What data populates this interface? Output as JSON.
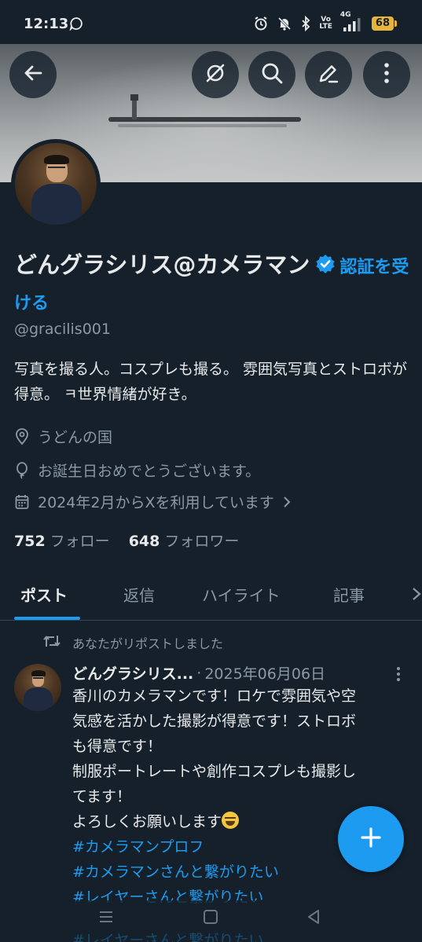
{
  "status_bar": {
    "time": "12:13",
    "network": "4G",
    "battery": "68",
    "volte_top": "Vo",
    "volte_bottom": "LTE"
  },
  "header": {
    "back_icon": "arrow-left-icon",
    "actions": [
      "grok-icon",
      "search-icon",
      "edit-icon",
      "more-vertical-icon"
    ]
  },
  "profile": {
    "display_name": "どんグラシリス@カメラマン",
    "verify_prompt": "認証を受ける",
    "handle": "@gracilis001",
    "bio": "写真を撮る人。コスプレも撮る。 雰囲気写真とストロボが得意。 ㅋ世界情緒が好き。",
    "location": "うどんの国",
    "birthday": "お誕生日おめでとうございます。",
    "joined": "2024年2月からXを利用しています",
    "following_count": "752",
    "following_label": "フォロー",
    "followers_count": "648",
    "followers_label": "フォロワー"
  },
  "tabs": [
    {
      "label": "ポスト",
      "active": true
    },
    {
      "label": "返信",
      "active": false
    },
    {
      "label": "ハイライト",
      "active": false
    },
    {
      "label": "記事",
      "active": false
    }
  ],
  "tweet": {
    "repost_text": "あなたがリポストしました",
    "author": "どんグラシリス...",
    "separator": "·",
    "date": "2025年06月06日",
    "lines": [
      "香川のカメラマンです！ロケで雰囲気や空",
      "気感を活かした撮影が得意です！ストロボ",
      "も得意です！",
      "制服ポートレートや創作コスプレも撮影し",
      "てます！",
      "よろしくお願いします"
    ],
    "emoji": "laughing-face-emoji",
    "hashtags": [
      "#カメラマンプロフ",
      "#カメラマンさんと繋がりたい",
      "#レイヤーさんと繋がりたい"
    ],
    "hashtag_peek": "#レイヤーさんと繋がりたい"
  },
  "fab": {
    "icon": "plus-icon"
  },
  "colors": {
    "background": "#15202b",
    "accent": "#1d9bf0",
    "text_primary": "#e7e9ea",
    "text_secondary": "#8b98a5",
    "battery": "#e8b53b"
  }
}
